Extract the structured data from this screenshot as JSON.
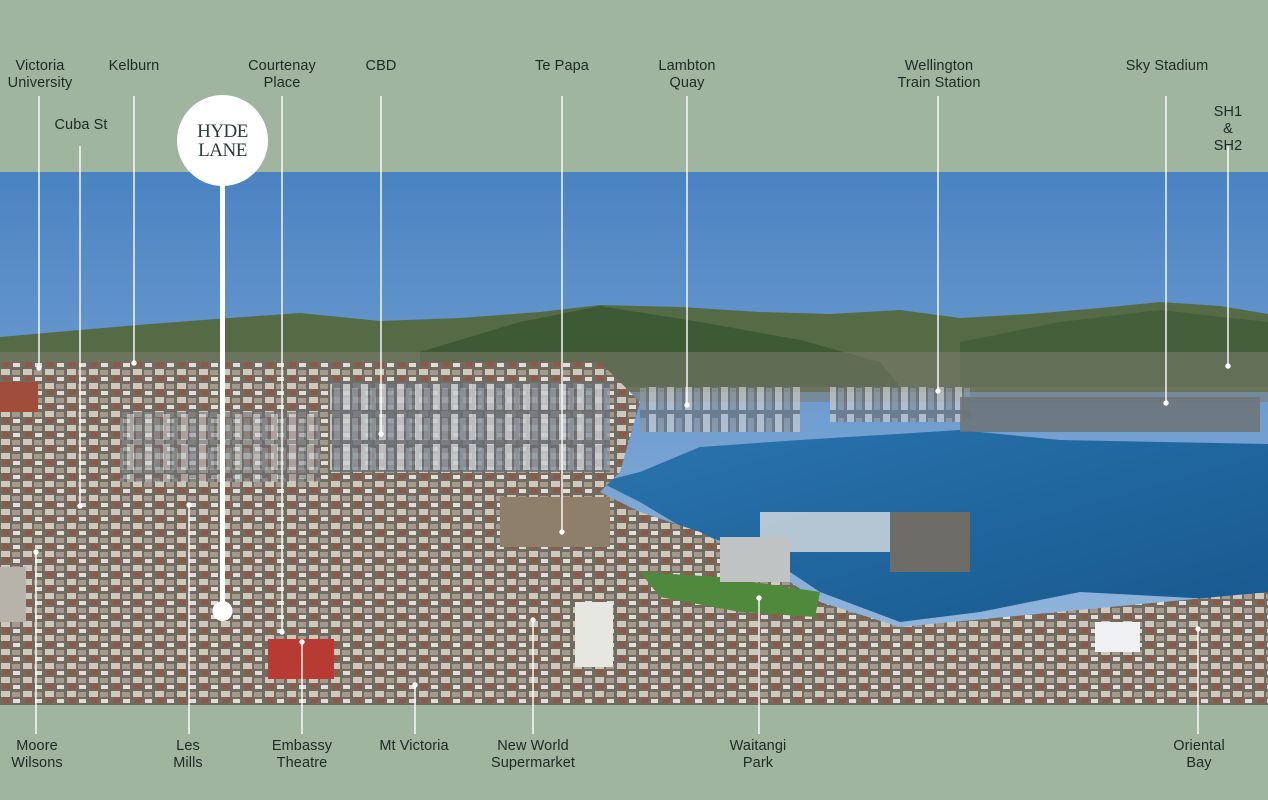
{
  "colors": {
    "band": "#9fb5a0",
    "label_text": "#1e2a24",
    "sky_top": "#4e86c4",
    "sky_bottom": "#8fb4da",
    "harbour": "#1e64a0",
    "hills": "#3f5a38",
    "leader_line": "#ffffff"
  },
  "logo": {
    "line1": "HYDE",
    "line2": "LANE"
  },
  "labels_top": [
    {
      "id": "victoria-university",
      "text": "Victoria\nUniversity"
    },
    {
      "id": "kelburn",
      "text": "Kelburn"
    },
    {
      "id": "cuba-st",
      "text": "Cuba St"
    },
    {
      "id": "courtenay-place",
      "text": "Courtenay\nPlace"
    },
    {
      "id": "cbd",
      "text": "CBD"
    },
    {
      "id": "te-papa",
      "text": "Te Papa"
    },
    {
      "id": "lambton-quay",
      "text": "Lambton\nQuay"
    },
    {
      "id": "wellington-train-station",
      "text": "Wellington\nTrain Station"
    },
    {
      "id": "sky-stadium",
      "text": "Sky Stadium"
    },
    {
      "id": "sh1-sh2",
      "text": "SH1 &\nSH2"
    }
  ],
  "labels_bottom": [
    {
      "id": "moore-wilsons",
      "text": "Moore\nWilsons"
    },
    {
      "id": "les-mills",
      "text": "Les\nMills"
    },
    {
      "id": "embassy-theatre",
      "text": "Embassy\nTheatre"
    },
    {
      "id": "mt-victoria",
      "text": "Mt Victoria"
    },
    {
      "id": "new-world-supermarket",
      "text": "New World\nSupermarket"
    },
    {
      "id": "waitangi-park",
      "text": "Waitangi\nPark"
    },
    {
      "id": "oriental-bay",
      "text": "Oriental Bay"
    }
  ]
}
